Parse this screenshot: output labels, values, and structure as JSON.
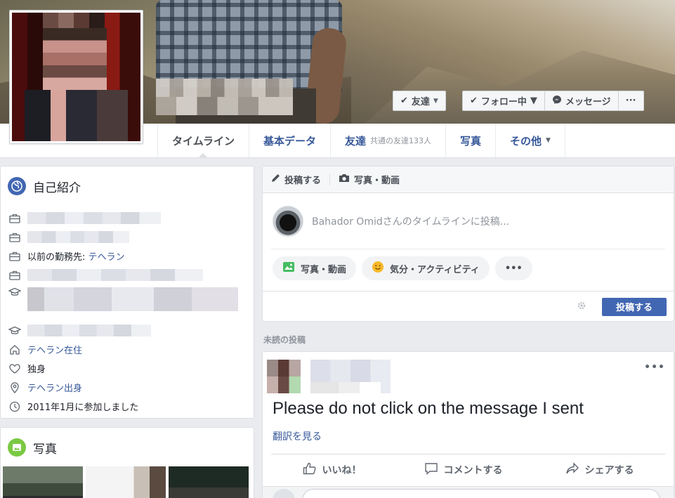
{
  "cover_buttons": {
    "friends": "友達",
    "following": "フォロー中",
    "message": "メッセージ",
    "more": "···"
  },
  "nav": {
    "timeline": "タイムライン",
    "about": "基本データ",
    "friends": "友達",
    "friends_sub": "共通の友達133人",
    "photos": "写真",
    "more": "その他"
  },
  "intro": {
    "title": "自己紹介",
    "work_prev_label": "以前の勤務先: ",
    "work_prev_place": "テヘラン",
    "lives": "テヘラン在住",
    "relationship": "独身",
    "from": "テヘラン出身",
    "joined": "2011年1月に参加しました"
  },
  "photos": {
    "title": "写真"
  },
  "composer": {
    "tab_post": "投稿する",
    "tab_photo": "写真・動画",
    "placeholder": "Bahador Omidさんのタイムラインに投稿...",
    "action_photo": "写真・動画",
    "action_feeling": "気分・アクティビティ",
    "action_more": "•••",
    "post_button": "投稿する"
  },
  "feed": {
    "section_label": "未読の投稿"
  },
  "post": {
    "text": "Please do not click on the message I sent",
    "translate": "翻訳を見る",
    "more": "•••",
    "like": "いいね！",
    "comment": "コメントする",
    "share": "シェアする"
  },
  "colors": {
    "link": "#365899",
    "primary_button": "#4267b2",
    "background": "#e9ebee"
  }
}
